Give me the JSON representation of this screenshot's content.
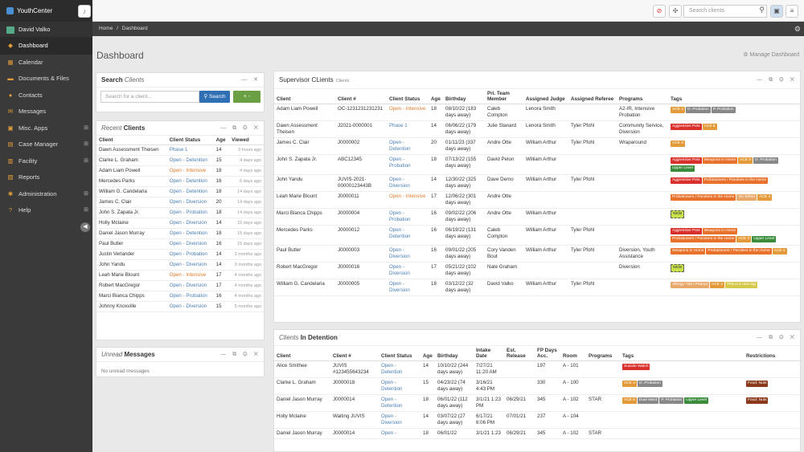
{
  "app": {
    "name": "YouthCenter"
  },
  "topbar": {
    "search_placeholder": "Search clients"
  },
  "sidebar": {
    "user": "David Valko",
    "items": [
      {
        "label": "Dashboard",
        "icon": "dashboard-icon",
        "glyph": "◆",
        "active": true,
        "expand": false
      },
      {
        "label": "Calendar",
        "icon": "calendar-icon",
        "glyph": "▦",
        "active": false,
        "expand": false
      },
      {
        "label": "Documents & Files",
        "icon": "folder-icon",
        "glyph": "▬",
        "active": false,
        "expand": false
      },
      {
        "label": "Contacts",
        "icon": "contacts-icon",
        "glyph": "●",
        "active": false,
        "expand": false
      },
      {
        "label": "Messages",
        "icon": "messages-icon",
        "glyph": "✉",
        "active": false,
        "expand": false
      },
      {
        "label": "Misc. Apps",
        "icon": "apps-icon",
        "glyph": "▣",
        "active": false,
        "expand": true
      },
      {
        "label": "Case Manager",
        "icon": "briefcase-icon",
        "glyph": "▤",
        "active": false,
        "expand": true
      },
      {
        "label": "Facility",
        "icon": "facility-icon",
        "glyph": "▥",
        "active": false,
        "expand": true
      },
      {
        "label": "Reports",
        "icon": "reports-icon",
        "glyph": "▧",
        "active": false,
        "expand": false
      },
      {
        "label": "Administration",
        "icon": "admin-icon",
        "glyph": "✱",
        "active": false,
        "expand": true
      },
      {
        "label": "Help",
        "icon": "help-icon",
        "glyph": "?",
        "active": false,
        "expand": true
      }
    ]
  },
  "breadcrumb": {
    "home": "Home",
    "sep": "/",
    "current": "Dashboard"
  },
  "page": {
    "title": "Dashboard",
    "manage": "Manage Dashboard"
  },
  "search_clients": {
    "title_a": "Search",
    "title_b": "Clients",
    "placeholder": "Search for a client...",
    "button": "Search",
    "add": "+ -"
  },
  "recent_clients": {
    "title_a": "Recent",
    "title_b": "Clients",
    "headers": [
      "Client",
      "Client Status",
      "Age",
      "Viewed"
    ],
    "rows": [
      {
        "client": "Dawn Assessment Theisen",
        "status": "Phase 1",
        "color": "blue",
        "age": "14",
        "viewed": "3 hours ago"
      },
      {
        "client": "Clarke L. Graham",
        "status": "Open - Detention",
        "color": "blue",
        "age": "15",
        "viewed": "4 days ago"
      },
      {
        "client": "Adam Liam Powell",
        "status": "Open - Intensive",
        "color": "orange",
        "age": "18",
        "viewed": "4 days ago"
      },
      {
        "client": "Mercedes Parks",
        "status": "Open - Detention",
        "color": "blue",
        "age": "16",
        "viewed": "6 days ago"
      },
      {
        "client": "William G. Candelaria",
        "status": "Open - Detention",
        "color": "blue",
        "age": "18",
        "viewed": "14 days ago"
      },
      {
        "client": "James C. Clair",
        "status": "Open - Diversion",
        "color": "blue",
        "age": "20",
        "viewed": "14 days ago"
      },
      {
        "client": "John S. Zapata Jr.",
        "status": "Open - Probation",
        "color": "blue",
        "age": "18",
        "viewed": "14 days ago"
      },
      {
        "client": "Holly Mclaine",
        "status": "Open - Diversion",
        "color": "blue",
        "age": "14",
        "viewed": "15 days ago"
      },
      {
        "client": "Daniel Jason Murray",
        "status": "Open - Detention",
        "color": "blue",
        "age": "18",
        "viewed": "15 days ago"
      },
      {
        "client": "Paul Butler",
        "status": "Open - Diversion",
        "color": "blue",
        "age": "16",
        "viewed": "15 days ago"
      },
      {
        "client": "Justin Verlander",
        "status": "Open - Probation",
        "color": "blue",
        "age": "14",
        "viewed": "3 months ago"
      },
      {
        "client": "John Yandu",
        "status": "Open - Diversion",
        "color": "blue",
        "age": "14",
        "viewed": "3 months ago"
      },
      {
        "client": "Leah Marie Blount",
        "status": "Open - Intensive",
        "color": "orange",
        "age": "17",
        "viewed": "4 months ago"
      },
      {
        "client": "Robert MacGregor",
        "status": "Open - Diversion",
        "color": "blue",
        "age": "17",
        "viewed": "4 months ago"
      },
      {
        "client": "Marci Bianca Chipps",
        "status": "Open - Probation",
        "color": "blue",
        "age": "16",
        "viewed": "4 months ago"
      },
      {
        "client": "Johnny Knoxville",
        "status": "Open - Diversion",
        "color": "blue",
        "age": "15",
        "viewed": "5 months ago"
      }
    ]
  },
  "unread_messages": {
    "title_a": "Unread",
    "title_b": "Messages",
    "empty": "No unread messages"
  },
  "supervisor": {
    "title": "Supervisor CLients",
    "subtitle": "Clients",
    "headers": [
      "Client",
      "Client #",
      "Client Status",
      "Age",
      "Birthday",
      "Pri. Team Member",
      "Assigned Judge",
      "Assigned Referee",
      "Programs",
      "Tags"
    ],
    "rows": [
      {
        "client": "Adam Liam Powell",
        "num": "OC-1231231231231",
        "status": "Open - Intensive",
        "color": "orange",
        "age": "18",
        "bday": "08/10/22 (183 days away)",
        "member": "Caleb Compton",
        "judge": "Lenora Smith",
        "referee": "",
        "programs": "A2-IR, Intensive Probation",
        "tags": [
          {
            "t": "ACE 3",
            "c": "#e39b3a"
          },
          {
            "t": "O. Probation",
            "c": "#888"
          },
          {
            "t": "P. Probation",
            "c": "#888"
          }
        ]
      },
      {
        "client": "Dawn Assessment Theisen",
        "num": "J2021-0000001",
        "status": "Phase 1",
        "color": "blue",
        "age": "14",
        "bday": "06/06/22 (179 days away)",
        "member": "Julie Stanard",
        "judge": "Lenora Smith",
        "referee": "Tyler Pfohl",
        "programs": "Community Service, Diversion",
        "tags": [
          {
            "t": "Aggressive Pets",
            "c": "#d9302c"
          },
          {
            "t": "ACE 5",
            "c": "#e39b3a"
          }
        ]
      },
      {
        "client": "James C. Clair",
        "num": "J0000002",
        "status": "Open - Detention",
        "color": "blue",
        "age": "20",
        "bday": "01/11/23 (337 days away)",
        "member": "Andre Otte",
        "judge": "William Arthur",
        "referee": "Tyler Pfohl",
        "programs": "Wraparound",
        "tags": [
          {
            "t": "ACE 3",
            "c": "#e39b3a"
          }
        ]
      },
      {
        "client": "John S. Zapata Jr.",
        "num": "ABC12345",
        "status": "Open - Probation",
        "color": "blue",
        "age": "18",
        "bday": "07/13/22 (155 days away)",
        "member": "David Pelon",
        "judge": "William Arthur",
        "referee": "",
        "programs": "",
        "tags": [
          {
            "t": "Aggressive Pets",
            "c": "#d9302c"
          },
          {
            "t": "Weapons in Home",
            "c": "#e8722c"
          },
          {
            "t": "ACE 3",
            "c": "#e39b3a"
          },
          {
            "t": "O. Probation",
            "c": "#888"
          },
          {
            "t": "Upper Level",
            "c": "#3a8c3a"
          }
        ]
      },
      {
        "client": "John Yandu",
        "num": "JUVIS-2021-00000123443B",
        "status": "Open - Diversion",
        "color": "blue",
        "age": "14",
        "bday": "12/30/22 (325 days away)",
        "member": "Dave Demo",
        "judge": "William Arthur",
        "referee": "Tyler Pfohl",
        "programs": "",
        "tags": [
          {
            "t": "Aggressive Pets",
            "c": "#d9302c"
          },
          {
            "t": "Probationers / Parolees in the Home",
            "c": "#e8722c"
          }
        ]
      },
      {
        "client": "Leah Marie Blount",
        "num": "J0000011",
        "status": "Open - Intensive",
        "color": "orange",
        "age": "17",
        "bday": "12/06/22 (301 days away)",
        "member": "Andre Otte",
        "judge": "",
        "referee": "",
        "programs": "",
        "tags": [
          {
            "t": "Probationers / Parolees in the Home",
            "c": "#e8722c"
          },
          {
            "t": "On Tether",
            "c": "#e8a86a"
          },
          {
            "t": "ACE 4",
            "c": "#e39b3a"
          }
        ]
      },
      {
        "client": "Marci Bianca Chipps",
        "num": "J0000004",
        "status": "Open - Probation",
        "color": "blue",
        "age": "16",
        "bday": "09/02/22 (206 days away)",
        "member": "Andre Otte",
        "judge": "William Arthur",
        "referee": "",
        "programs": "",
        "tags": [
          {
            "t": "NEW",
            "c": "#c8e04a"
          }
        ]
      },
      {
        "client": "Mercedes Parks",
        "num": "J0000012",
        "status": "Open - Detention",
        "color": "blue",
        "age": "16",
        "bday": "06/19/22 (131 days away)",
        "member": "Caleb Compton",
        "judge": "William Arthur",
        "referee": "Tyler Pfohl",
        "programs": "",
        "tags": [
          {
            "t": "Aggressive Pets",
            "c": "#d9302c"
          },
          {
            "t": "Weapons in Home",
            "c": "#e8722c"
          },
          {
            "t": "Probationers / Parolees in the Home",
            "c": "#e8722c"
          },
          {
            "t": "ACE 3",
            "c": "#e39b3a"
          },
          {
            "t": "Upper Level",
            "c": "#3a8c3a"
          }
        ]
      },
      {
        "client": "Paul Butler",
        "num": "J0000003",
        "status": "Open - Diversion",
        "color": "blue",
        "age": "16",
        "bday": "09/01/22 (205 days away)",
        "member": "Cory Vanden Bout",
        "judge": "William Arthur",
        "referee": "Tyler Pfohl",
        "programs": "Diversion, Youth Assistance",
        "tags": [
          {
            "t": "Weapons in Home",
            "c": "#e8722c"
          },
          {
            "t": "Probationers / Parolees in the Home",
            "c": "#e8722c"
          },
          {
            "t": "ACE 4",
            "c": "#e39b3a"
          }
        ]
      },
      {
        "client": "Robert MacGregor",
        "num": "J0000016",
        "status": "Open - Diversion",
        "color": "blue",
        "age": "17",
        "bday": "05/21/22 (102 days away)",
        "member": "Nate Graham",
        "judge": "",
        "referee": "",
        "programs": "Diversion",
        "tags": [
          {
            "t": "NEW",
            "c": "#c8e04a"
          }
        ]
      },
      {
        "client": "William G. Candelaria",
        "num": "J0000005",
        "status": "Open - Diversion",
        "color": "blue",
        "age": "18",
        "bday": "03/12/22 (32 days away)",
        "member": "David Valko",
        "judge": "William Arthur",
        "referee": "Tyler Pfohl",
        "programs": "",
        "tags": [
          {
            "t": "Allergy: Nut / Peanut",
            "c": "#e8a86a"
          },
          {
            "t": "ACE 4",
            "c": "#e39b3a"
          },
          {
            "t": "This is a new tag",
            "c": "#d6c94a"
          }
        ]
      }
    ]
  },
  "detention": {
    "title_a": "Clients",
    "title_b": "In Detention",
    "headers": [
      "Client",
      "Client #",
      "Client Status",
      "Age",
      "Birthday",
      "Intake Date",
      "Est. Release",
      "FP Days Acc.",
      "Room",
      "Programs",
      "Tags",
      "Restrictions"
    ],
    "rows": [
      {
        "client": "Alice Smithee",
        "num": "JUVIS #123455643234",
        "status": "Open - Detention",
        "age": "14",
        "bday": "10/10/22 (244 days away)",
        "intake": "7/27/21 11:20 AM",
        "release": "",
        "fp": "197",
        "room": "A - 101",
        "programs": "",
        "tags": [
          {
            "t": "Suicide Watch",
            "c": "#d9302c"
          }
        ],
        "restr": []
      },
      {
        "client": "Clarke L. Graham",
        "num": "J0000018",
        "status": "Open - Detention",
        "age": "15",
        "bday": "04/23/22 (74 days away)",
        "intake": "3/16/21 4:43 PM",
        "release": "",
        "fp": "330",
        "room": "A - 100",
        "programs": "",
        "tags": [
          {
            "t": "ACE 4",
            "c": "#e39b3a"
          },
          {
            "t": "O. Probation",
            "c": "#888"
          }
        ],
        "restr": [
          {
            "t": "Food: Nuts",
            "c": "#8a3a1a"
          }
        ]
      },
      {
        "client": "Daniel Jason Murray",
        "num": "J0000014",
        "status": "Open - Detention",
        "age": "18",
        "bday": "06/01/22 (112 days away)",
        "intake": "3/1/21 1:23 PM",
        "release": "06/29/21",
        "fp": "345",
        "room": "A - 102",
        "programs": "STAR",
        "tags": [
          {
            "t": "ACE 5",
            "c": "#e39b3a"
          },
          {
            "t": "Dual Ward",
            "c": "#888"
          },
          {
            "t": "P. Probation",
            "c": "#888"
          },
          {
            "t": "Upper Level",
            "c": "#3a8c3a"
          }
        ],
        "restr": [
          {
            "t": "Food: Nuts",
            "c": "#8a3a1a"
          }
        ]
      },
      {
        "client": "Holly Mclaine",
        "num": "Waiting JUVIS",
        "status": "Open - Diversion",
        "age": "14",
        "bday": "03/07/22 (27 days away)",
        "intake": "6/17/21 6:06 PM",
        "release": "07/01/21",
        "fp": "237",
        "room": "A - 104",
        "programs": "",
        "tags": [],
        "restr": []
      },
      {
        "client": "Daniel Jason Murray",
        "num": "J0000014",
        "status": "Open -",
        "age": "18",
        "bday": "06/01/22",
        "intake": "3/1/21 1:23",
        "release": "06/29/21",
        "fp": "345",
        "room": "A - 102",
        "programs": "STAR",
        "tags": [],
        "restr": []
      }
    ]
  }
}
